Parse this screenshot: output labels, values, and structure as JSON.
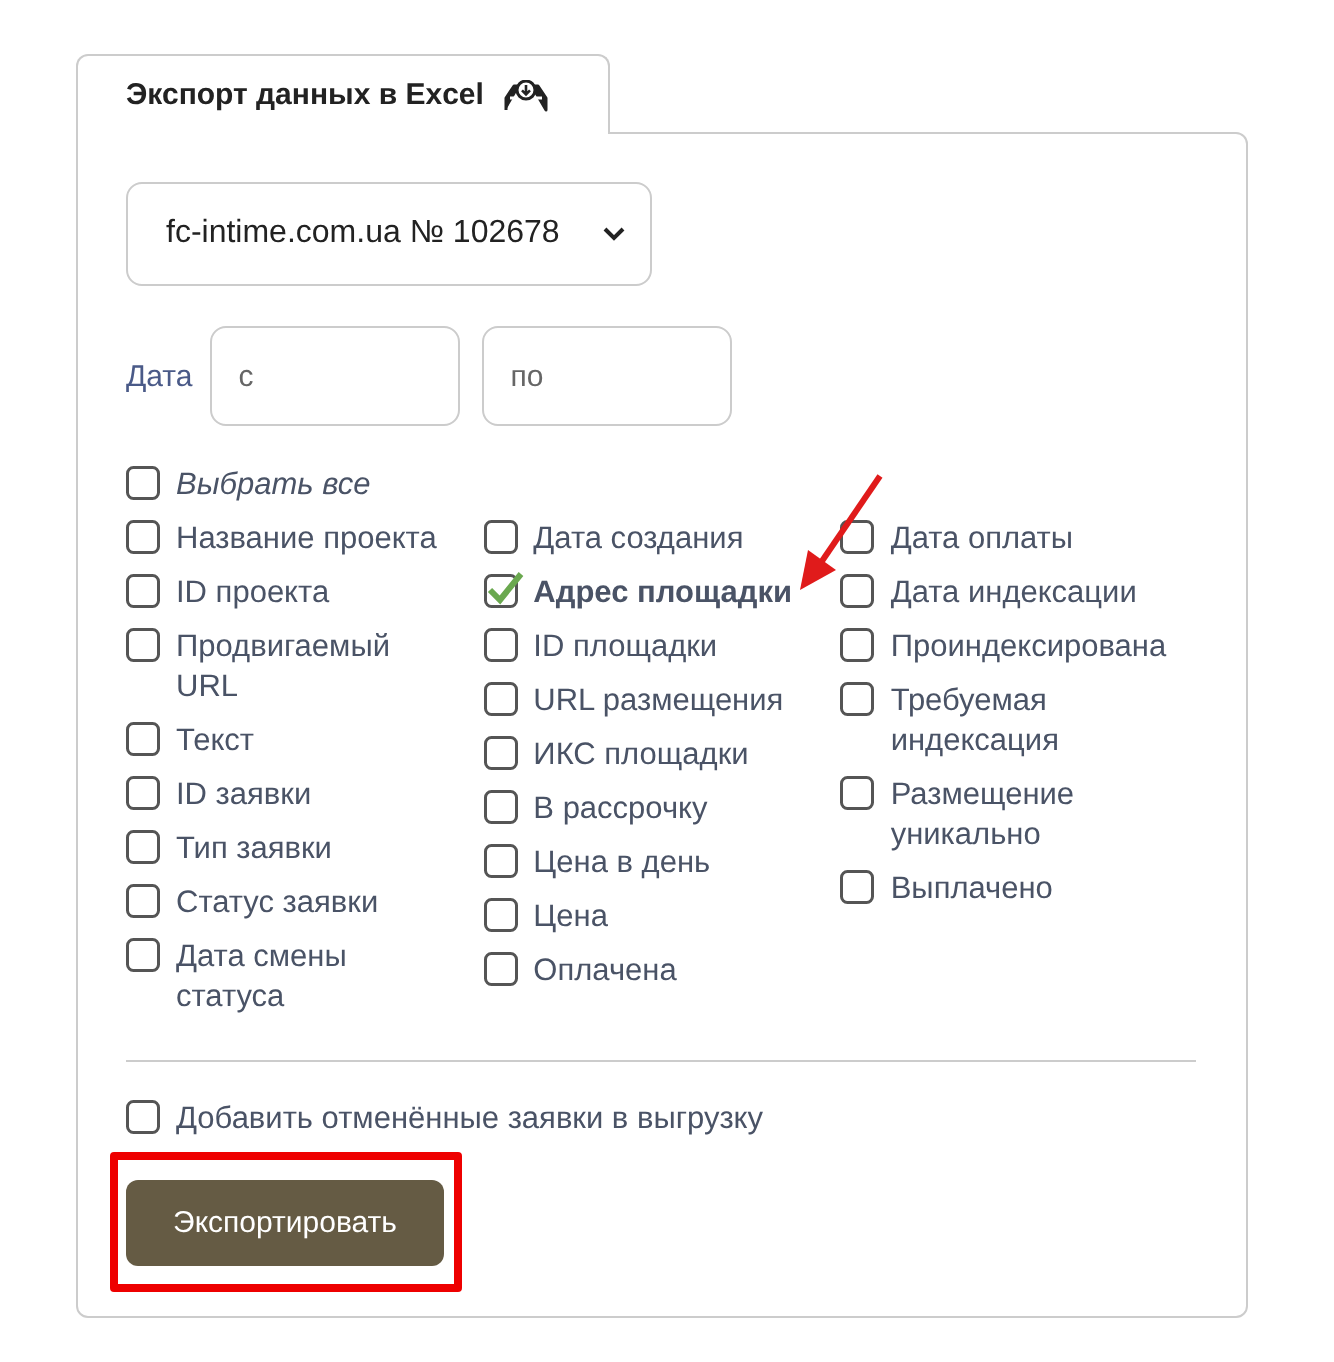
{
  "tab": {
    "label": "Экспорт данных в Excel",
    "selected": true
  },
  "site_select": {
    "value": "fc-intime.com.ua № 102678"
  },
  "date": {
    "label": "Дата",
    "from": {
      "placeholder": "с"
    },
    "to": {
      "placeholder": "по"
    }
  },
  "select_all": {
    "label": "Выбрать все",
    "checked": false
  },
  "columns": [
    [
      {
        "label": "Название проекта",
        "checked": false
      },
      {
        "label": "ID проекта",
        "checked": false
      },
      {
        "label": "Продвигаемый URL",
        "checked": false
      },
      {
        "label": "Текст",
        "checked": false
      },
      {
        "label": "ID заявки",
        "checked": false
      },
      {
        "label": "Тип заявки",
        "checked": false
      },
      {
        "label": "Статус заявки",
        "checked": false
      },
      {
        "label": "Дата смены статуса",
        "checked": false
      }
    ],
    [
      {
        "label": "Дата создания",
        "checked": false
      },
      {
        "label": "Адрес площадки",
        "checked": true
      },
      {
        "label": "ID площадки",
        "checked": false
      },
      {
        "label": "URL размещения",
        "checked": false
      },
      {
        "label": "ИКС площадки",
        "checked": false
      },
      {
        "label": "В рассрочку",
        "checked": false
      },
      {
        "label": "Цена в день",
        "checked": false
      },
      {
        "label": "Цена",
        "checked": false
      },
      {
        "label": "Оплачена",
        "checked": false
      }
    ],
    [
      {
        "label": "Дата оплаты",
        "checked": false
      },
      {
        "label": "Дата индексации",
        "checked": false
      },
      {
        "label": "Проиндексирована",
        "checked": false
      },
      {
        "label": "Требуемая индексация",
        "checked": false
      },
      {
        "label": "Размещение уникально",
        "checked": false
      },
      {
        "label": "Выплачено",
        "checked": false
      }
    ]
  ],
  "add_cancelled": {
    "label": "Добавить отменённые заявки в выгрузку",
    "checked": false
  },
  "export_button": {
    "label": "Экспортировать"
  },
  "annotations": {
    "arrow": true,
    "frame": true
  }
}
